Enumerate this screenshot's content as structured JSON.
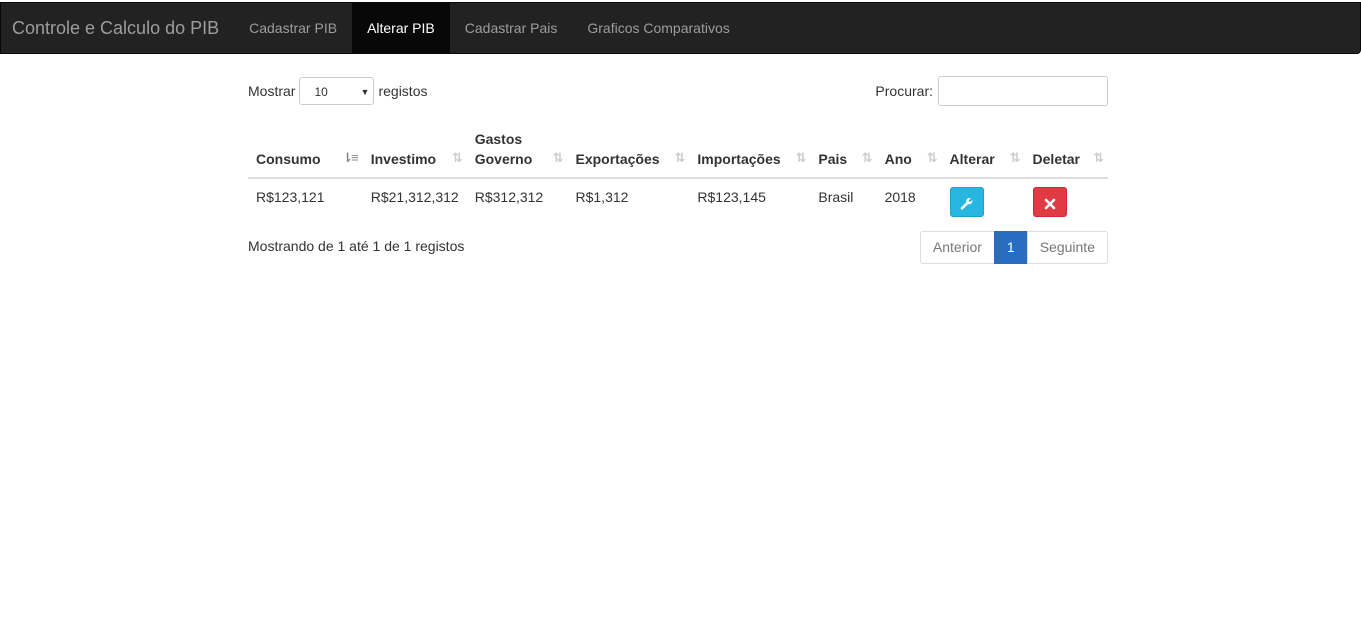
{
  "navbar": {
    "brand": "Controle e Calculo do PIB",
    "items": [
      {
        "label": "Cadastrar PIB",
        "active": false
      },
      {
        "label": "Alterar PIB",
        "active": true
      },
      {
        "label": "Cadastrar Pais",
        "active": false
      },
      {
        "label": "Graficos Comparativos",
        "active": false
      }
    ]
  },
  "table_controls": {
    "show_label": "Mostrar",
    "page_size": "10",
    "records_label": "registos",
    "search_label": "Procurar:",
    "search_value": ""
  },
  "table": {
    "headers": {
      "consumo": "Consumo",
      "investimo": "Investimo",
      "gastos_governo_line1": "Gastos",
      "gastos_governo_line2": "Governo",
      "exportacoes": "Exportações",
      "importacoes": "Importações",
      "pais": "Pais",
      "ano": "Ano",
      "alterar": "Alterar",
      "deletar": "Deletar"
    },
    "sorted_column": "Consumo",
    "rows": [
      {
        "consumo": "R$123,121",
        "investimo": "R$21,312,312",
        "gastos_governo": "R$312,312",
        "exportacoes": "R$1,312",
        "importacoes": "R$123,145",
        "pais": "Brasil",
        "ano": "2018",
        "edit_icon": "wrench-icon",
        "delete_icon": "close-icon"
      }
    ]
  },
  "footer": {
    "info": "Mostrando de 1 até 1 de 1 registos",
    "pagination": {
      "previous": "Anterior",
      "current": "1",
      "next": "Seguinte"
    }
  },
  "colors": {
    "navbar_bg": "#222222",
    "active_nav_bg": "#080808",
    "edit_button": "#26b6e0",
    "delete_button": "#e03a45",
    "current_page": "#2a6cbf"
  }
}
